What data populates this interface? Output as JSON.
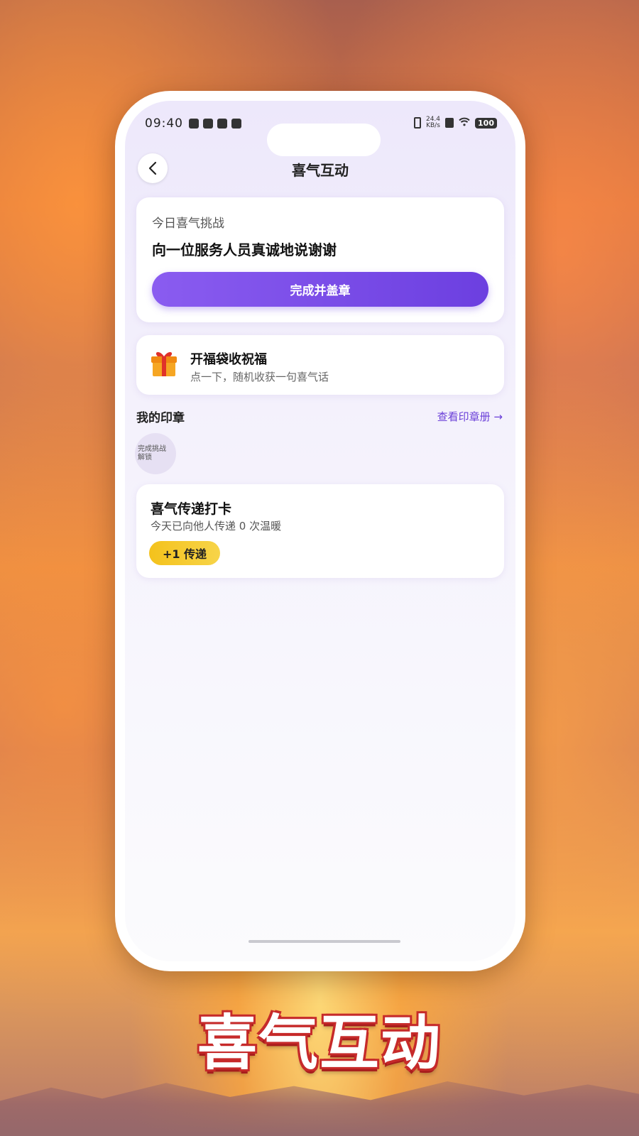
{
  "status_bar": {
    "time": "09:40",
    "net_speed_value": "24.4",
    "net_speed_unit": "KB/s",
    "battery": "100"
  },
  "header": {
    "title": "喜气互动"
  },
  "challenge": {
    "label": "今日喜气挑战",
    "text": "向一位服务人员真诚地说谢谢",
    "button_label": "完成并盖章"
  },
  "gift": {
    "title": "开福袋收祝福",
    "subtitle": "点一下，随机收获一句喜气话"
  },
  "stamps": {
    "title": "我的印章",
    "link_label": "查看印章册 →",
    "placeholder_line1": "完成挑战",
    "placeholder_line2": "解锁"
  },
  "relay": {
    "title": "喜气传递打卡",
    "subtitle": "今天已向他人传递 0 次温暖",
    "button_label": "+1 传递"
  },
  "banner": {
    "title": "喜气互动"
  },
  "colors": {
    "accent_purple": "#7a4ee8",
    "accent_yellow": "#f4c21c",
    "banner_outline": "#c62a2a"
  }
}
